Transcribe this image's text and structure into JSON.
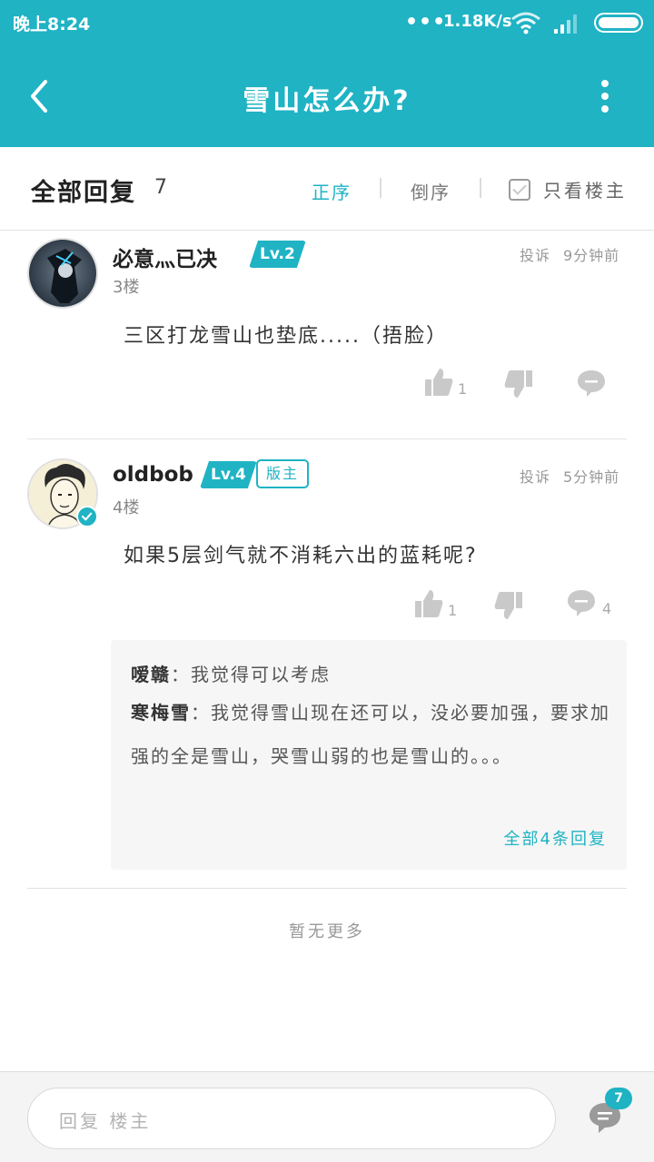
{
  "status_bar": {
    "time": "晚上8:24",
    "dots": "•••",
    "speed": "1.18K/s",
    "icons": [
      "wifi-icon",
      "signal-icon",
      "battery-icon"
    ]
  },
  "header": {
    "title": "雪山怎么办?",
    "icons": [
      "back-icon",
      "more-vertical-icon"
    ]
  },
  "filter": {
    "all_replies_label": "全部回复",
    "count": "7",
    "sort_asc": "正序",
    "sort_desc": "倒序",
    "op_only": "只看楼主"
  },
  "posts": [
    {
      "username": "​必意灬已决",
      "level": "Lv.2",
      "report": "投诉",
      "time": "9分钟前",
      "floor": "3楼",
      "content": "三区打龙雪山也垫底.....（捂脸）",
      "likes": "1",
      "dislikes": "",
      "comments": ""
    },
    {
      "username": "oldbob",
      "level": "Lv.4",
      "badge": "版主",
      "report": "投诉",
      "time": "5分钟前",
      "floor": "4楼",
      "content": "如果5层剑气就不消耗六出的蓝耗呢?",
      "likes": "1",
      "dislikes": "",
      "comments": "4",
      "sub_replies": [
        {
          "user": "嗳赣",
          "sep": "：",
          "text": "我觉得可以考虑"
        },
        {
          "user": "寒梅雪",
          "sep": "：",
          "text": "我觉得雪山现在还可以，没必要加强，要求加强的全是雪山，哭雪山弱的也是雪山的。。。"
        }
      ],
      "view_all": "全部4条回复"
    }
  ],
  "footer_note": "暂无更多",
  "bottom": {
    "reply_placeholder": "回复  楼主",
    "comment_count": "7"
  },
  "colors": {
    "accent": "#1fb3c4",
    "text": "#333333",
    "muted": "#999999"
  }
}
